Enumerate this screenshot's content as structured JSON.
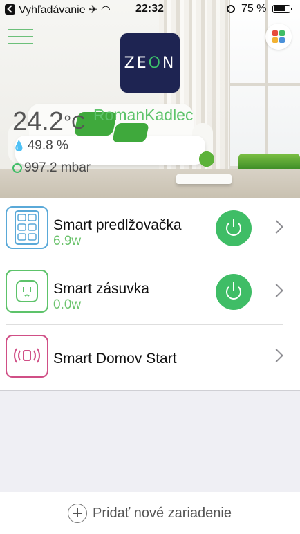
{
  "status_bar": {
    "carrier": "Vyhľadávanie",
    "time": "22:32",
    "battery": "75 %"
  },
  "header": {
    "logo_text_1": "Z",
    "logo_text_2": "E",
    "logo_text_3": "O",
    "logo_text_4": "N",
    "user_name": "RomanKadlec",
    "temperature": "24.2",
    "temperature_unit": "°C",
    "humidity": "49.8 %",
    "pressure": "997.2 mbar"
  },
  "devices": [
    {
      "name": "Smart predlžovačka",
      "power": "6.9w",
      "icon": "power-strip-icon",
      "color": "#5aa9d8",
      "has_power_button": true
    },
    {
      "name": "Smart zásuvka",
      "power": "0.0w",
      "icon": "socket-icon",
      "color": "#5dc36a",
      "has_power_button": true
    },
    {
      "name": "Smart Domov Start",
      "power": "",
      "icon": "hub-icon",
      "color": "#d04f86",
      "has_power_button": false
    }
  ],
  "footer": {
    "add_label": "Pridať nové zariadenie"
  },
  "colors": {
    "accent_green": "#3fbd66",
    "brand_navy": "#1e2452"
  }
}
